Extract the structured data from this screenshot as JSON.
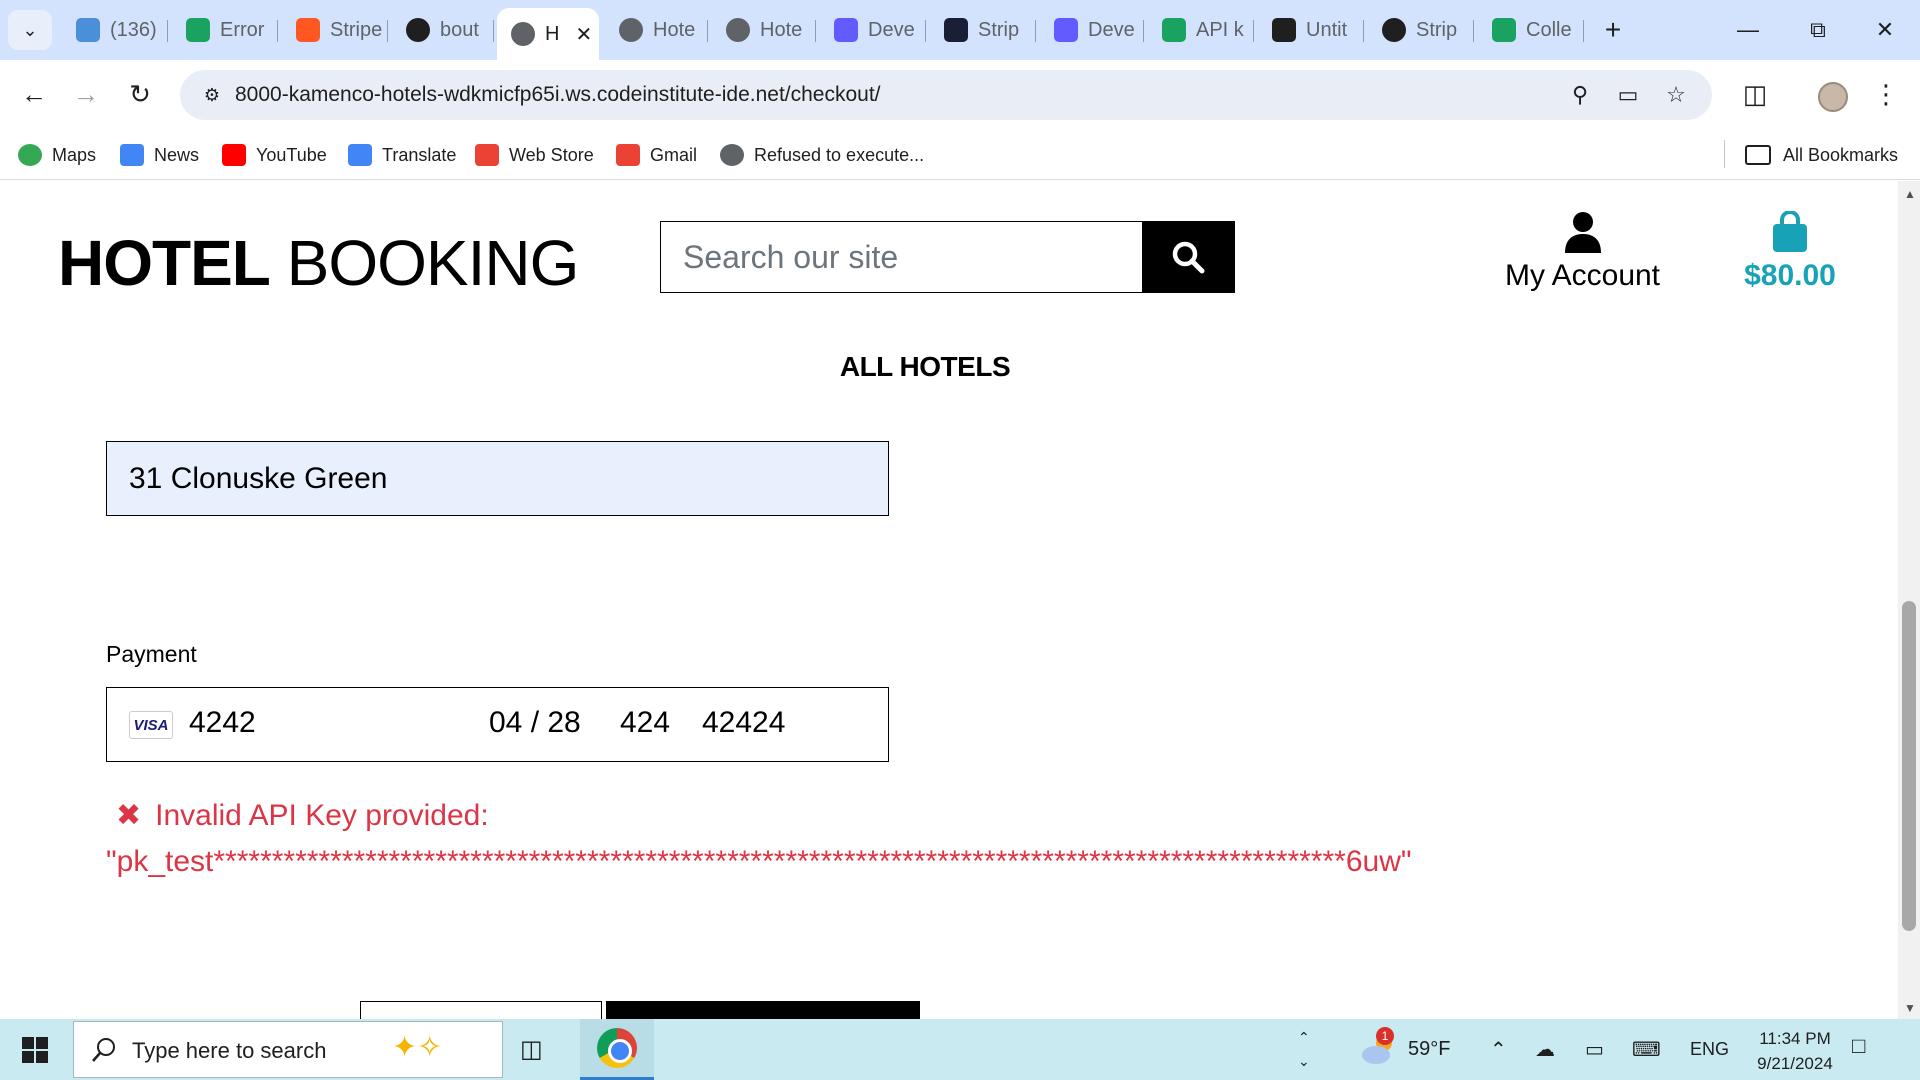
{
  "browser": {
    "tabs": [
      {
        "title": "(136)",
        "favicon": "app-icon",
        "color": "#4a8fd8"
      },
      {
        "title": "Error",
        "favicon": "s-green-icon",
        "color": "#1aa260"
      },
      {
        "title": "Stripe",
        "favicon": "stripe-orange-icon",
        "color": "#ff5722"
      },
      {
        "title": "bout",
        "favicon": "github-icon",
        "color": "#1f1f1f"
      },
      {
        "title": "H",
        "favicon": "globe-icon",
        "color": "#5f6368",
        "active": true
      },
      {
        "title": "Hote",
        "favicon": "globe-icon",
        "color": "#5f6368"
      },
      {
        "title": "Hote",
        "favicon": "globe-icon",
        "color": "#5f6368"
      },
      {
        "title": "Deve",
        "favicon": "s-purple-icon",
        "color": "#635bff"
      },
      {
        "title": "Strip",
        "favicon": "s-dark-icon",
        "color": "#1a1f36"
      },
      {
        "title": "Deve",
        "favicon": "s-purple-icon",
        "color": "#635bff"
      },
      {
        "title": "API k",
        "favicon": "s-green-icon",
        "color": "#1aa260"
      },
      {
        "title": "Untit",
        "favicon": "d-icon",
        "color": "#1f1f1f"
      },
      {
        "title": "Strip",
        "favicon": "openai-icon",
        "color": "#1f1f1f"
      },
      {
        "title": "Colle",
        "favicon": "s-green-icon",
        "color": "#1aa260"
      }
    ],
    "url": "8000-kamenco-hotels-wdkmicfp65i.ws.codeinstitute-ide.net/checkout/",
    "bookmarks": [
      {
        "label": "Maps",
        "icon": "maps-icon",
        "color": "#34a853"
      },
      {
        "label": "News",
        "icon": "news-icon",
        "color": "#4285f4"
      },
      {
        "label": "YouTube",
        "icon": "youtube-icon",
        "color": "#ff0000"
      },
      {
        "label": "Translate",
        "icon": "translate-icon",
        "color": "#4285f4"
      },
      {
        "label": "Web Store",
        "icon": "webstore-icon",
        "color": "#ea4335"
      },
      {
        "label": "Gmail",
        "icon": "gmail-icon",
        "color": "#ea4335"
      },
      {
        "label": "Refused to execute...",
        "icon": "globe-icon",
        "color": "#5f6368"
      }
    ],
    "all_bookmarks_label": "All Bookmarks"
  },
  "site": {
    "logo_bold": "HOTEL",
    "logo_light": "BOOKING",
    "search_placeholder": "Search our site",
    "account_label": "My Account",
    "bag_total": "$80.00",
    "nav_all_hotels": "ALL HOTELS"
  },
  "checkout": {
    "address_value": "31 Clonuske Green",
    "payment_label": "Payment",
    "card": {
      "brand": "VISA",
      "number": "4242",
      "expiry": "04 / 28",
      "cvc": "424",
      "zip": "42424"
    },
    "error_text": "Invalid API Key provided:",
    "error_key": "\"pk_test*************************************************************************************************6uw\"",
    "error_color": "#dc3545"
  },
  "taskbar": {
    "search_placeholder": "Type here to search",
    "weather_temp": "59°F",
    "weather_badge": "1",
    "language": "ENG",
    "time": "11:34 PM",
    "date": "9/21/2024"
  }
}
